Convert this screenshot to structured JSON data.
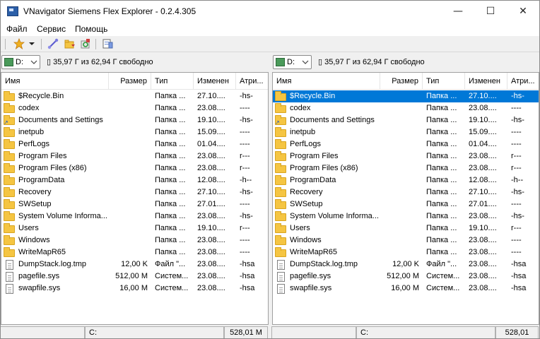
{
  "window": {
    "title": "VNavigator Siemens Flex Explorer - 0.2.4.305",
    "minimize": "—",
    "maximize": "☐",
    "close": "✕"
  },
  "menu": [
    "Файл",
    "Сервис",
    "Помощь"
  ],
  "toolbar": {
    "icons": [
      "star-icon",
      "dropdown-arrow-icon",
      "connect-icon",
      "folder-sync-icon",
      "recycle-icon",
      "settings-icon"
    ]
  },
  "columns": {
    "name": "Имя",
    "size": "Размер",
    "type": "Тип",
    "modified": "Изменен",
    "attrs": "Атри..."
  },
  "panels": {
    "left": {
      "drive": "D:",
      "free_space": "35,97 Г из 62,94 Г свободно",
      "status_path": "C:",
      "status_size": "528,01 M",
      "selected_index": -1
    },
    "right": {
      "drive": "D:",
      "free_space": "35,97 Г из 62,94 Г свободно",
      "status_path": "C:",
      "status_size": "528,01",
      "selected_index": 0
    }
  },
  "files": [
    {
      "name": "$Recycle.Bin",
      "size": "",
      "type": "Папка ...",
      "modified": "27.10....",
      "attrs": "-hs-",
      "icon": "folder",
      "shortcut": false
    },
    {
      "name": "codex",
      "size": "",
      "type": "Папка ...",
      "modified": "23.08....",
      "attrs": "----",
      "icon": "folder",
      "shortcut": false
    },
    {
      "name": "Documents and Settings",
      "size": "",
      "type": "Папка ...",
      "modified": "19.10....",
      "attrs": "-hs-",
      "icon": "folder",
      "shortcut": true
    },
    {
      "name": "inetpub",
      "size": "",
      "type": "Папка ...",
      "modified": "15.09....",
      "attrs": "----",
      "icon": "folder",
      "shortcut": false
    },
    {
      "name": "PerfLogs",
      "size": "",
      "type": "Папка ...",
      "modified": "01.04....",
      "attrs": "----",
      "icon": "folder",
      "shortcut": false
    },
    {
      "name": "Program Files",
      "size": "",
      "type": "Папка ...",
      "modified": "23.08....",
      "attrs": "r---",
      "icon": "folder",
      "shortcut": false
    },
    {
      "name": "Program Files (x86)",
      "size": "",
      "type": "Папка ...",
      "modified": "23.08....",
      "attrs": "r---",
      "icon": "folder",
      "shortcut": false
    },
    {
      "name": "ProgramData",
      "size": "",
      "type": "Папка ...",
      "modified": "12.08....",
      "attrs": "-h--",
      "icon": "folder",
      "shortcut": false
    },
    {
      "name": "Recovery",
      "size": "",
      "type": "Папка ...",
      "modified": "27.10....",
      "attrs": "-hs-",
      "icon": "folder",
      "shortcut": false
    },
    {
      "name": "SWSetup",
      "size": "",
      "type": "Папка ...",
      "modified": "27.01....",
      "attrs": "----",
      "icon": "folder",
      "shortcut": false
    },
    {
      "name": "System Volume Informa...",
      "size": "",
      "type": "Папка ...",
      "modified": "23.08....",
      "attrs": "-hs-",
      "icon": "folder",
      "shortcut": false
    },
    {
      "name": "Users",
      "size": "",
      "type": "Папка ...",
      "modified": "19.10....",
      "attrs": "r---",
      "icon": "folder",
      "shortcut": false
    },
    {
      "name": "Windows",
      "size": "",
      "type": "Папка ...",
      "modified": "23.08....",
      "attrs": "----",
      "icon": "folder",
      "shortcut": false
    },
    {
      "name": "WriteMapR65",
      "size": "",
      "type": "Папка ...",
      "modified": "23.08....",
      "attrs": "----",
      "icon": "folder",
      "shortcut": false
    },
    {
      "name": "DumpStack.log.tmp",
      "size": "12,00 K",
      "type": "Файл \"...",
      "modified": "23.08....",
      "attrs": "-hsa",
      "icon": "file",
      "shortcut": false
    },
    {
      "name": "pagefile.sys",
      "size": "512,00 M",
      "type": "Систем...",
      "modified": "23.08....",
      "attrs": "-hsa",
      "icon": "file",
      "shortcut": false
    },
    {
      "name": "swapfile.sys",
      "size": "16,00 M",
      "type": "Систем...",
      "modified": "23.08....",
      "attrs": "-hsa",
      "icon": "file",
      "shortcut": false
    }
  ]
}
